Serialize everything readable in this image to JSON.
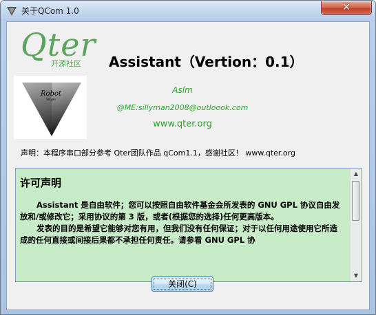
{
  "window": {
    "title": "关于QCom 1.0",
    "close_symbol": "✕"
  },
  "logo": {
    "brand": "Qter",
    "subtitle": "开源社区"
  },
  "app_title": "Assistant（Vertion：0.1）",
  "robot_image": {
    "label": "Robot",
    "sublabel": "Sillymi"
  },
  "author": {
    "name": "Aslm",
    "email": "@ME:sillyman2008@outloook.com",
    "website": "www.qter.org"
  },
  "notice": "声明：本程序串口部分参考 Qter团队作品 qCom1.1，感谢社区！  www.qter.org",
  "license": {
    "heading": "许可声明",
    "paragraph1": "Assistant 是自由软件；您可以按照自由软件基金会所发表的 GNU GPL 协议自由发放和/或修改它；采用协议的第 3 版，或者(根据您的选择)任何更高版本。",
    "paragraph2": "发表的目的是希望它能够对您有用，但我们没有任何保证；对于以任何用途使用它所造成的任何直接或间接后果都不承担任何责任。请参看 GNU GPL 协"
  },
  "buttons": {
    "close_label": "关闭(C)"
  },
  "colors": {
    "accent_green": "#2aa42a",
    "logo_green": "#5ba45b",
    "license_bg": "#c8ecc8"
  }
}
